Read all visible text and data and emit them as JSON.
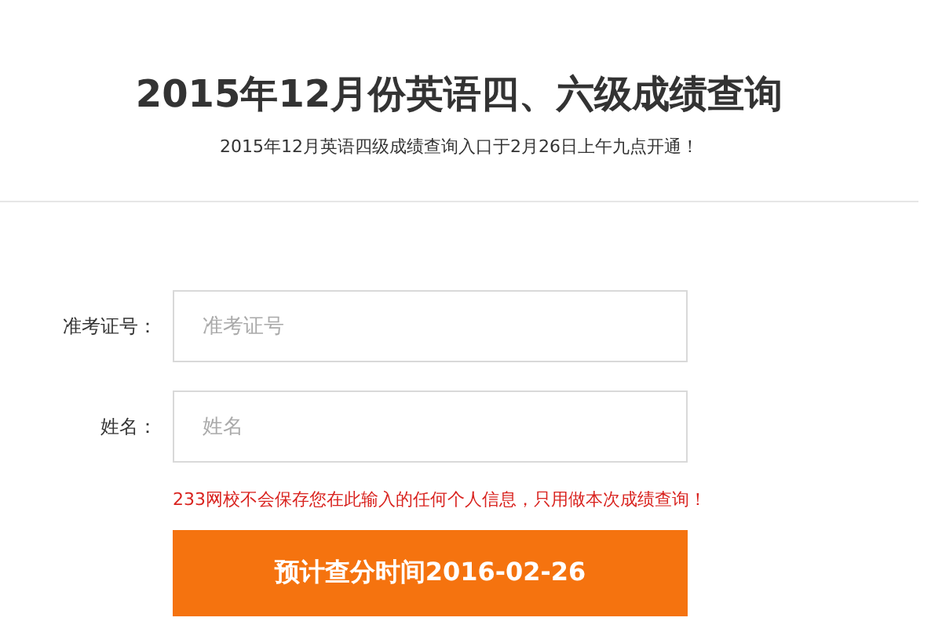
{
  "header": {
    "title": "2015年12月份英语四、六级成绩查询",
    "subtitle": "2015年12月英语四级成绩查询入口于2月26日上午九点开通！"
  },
  "form": {
    "fields": [
      {
        "label": "准考证号：",
        "placeholder": "准考证号"
      },
      {
        "label": "姓名：",
        "placeholder": "姓名"
      }
    ],
    "notice": "233网校不会保存您在此输入的任何个人信息，只用做本次成绩查询！",
    "button": "预计查分时间2016-02-26"
  }
}
